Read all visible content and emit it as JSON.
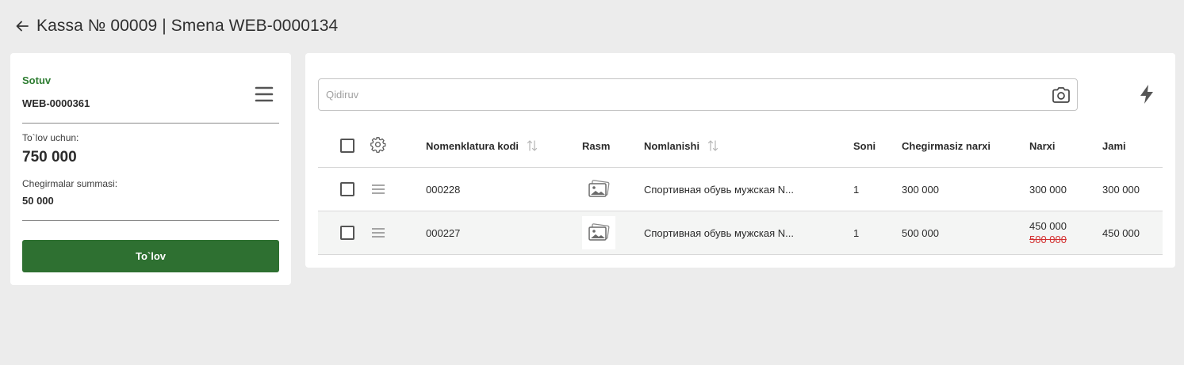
{
  "header": {
    "title": "Kassa № 00009 | Smena WEB-0000134"
  },
  "sale_panel": {
    "type_label": "Sotuv",
    "sale_number": "WEB-0000361",
    "pay_label": "To`lov uchun:",
    "pay_amount": "750 000",
    "discount_label": "Chegirmalar summasi:",
    "discount_amount": "50 000",
    "pay_button": "To`lov"
  },
  "search": {
    "placeholder": "Qidiruv",
    "value": ""
  },
  "table": {
    "columns": {
      "code": "Nomenklatura kodi",
      "image": "Rasm",
      "name": "Nomlanishi",
      "qty": "Soni",
      "price_no_discount": "Chegirmasiz narxi",
      "price": "Narxi",
      "total": "Jami"
    },
    "rows": [
      {
        "code": "000228",
        "name": "Спортивная обувь мужская N...",
        "qty": "1",
        "price_no_discount": "300 000",
        "price": "300 000",
        "old_price": "",
        "total": "300 000"
      },
      {
        "code": "000227",
        "name": "Спортивная обувь мужская N...",
        "qty": "1",
        "price_no_discount": "500 000",
        "price": "450 000",
        "old_price": "500 000",
        "total": "450 000"
      }
    ]
  },
  "colors": {
    "accent_green": "#2e7031",
    "label_green": "#2e7d32",
    "strike_red": "#d32f2f"
  },
  "icons": [
    "arrow-left-icon",
    "hamburger-menu-icon",
    "camera-icon",
    "lightning-bolt-icon",
    "gear-icon",
    "sort-arrows-icon",
    "drag-handle-icon",
    "image-placeholder-icon"
  ]
}
